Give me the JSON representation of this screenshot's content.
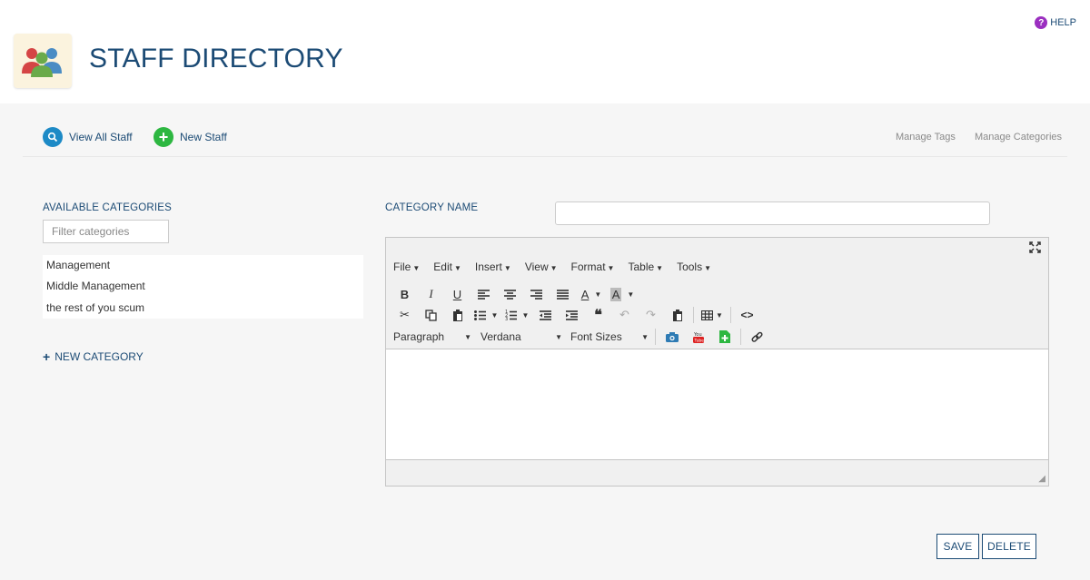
{
  "header": {
    "app_title": "STAFF DIRECTORY",
    "help_label": "HELP",
    "help_icon": "?"
  },
  "actions": {
    "view_all_label": "View All Staff",
    "new_staff_label": "New Staff",
    "manage_tags_label": "Manage Tags",
    "manage_categories_label": "Manage Categories"
  },
  "categories": {
    "heading": "AVAILABLE CATEGORIES",
    "filter_placeholder": "Filter categories",
    "items": [
      "Management",
      "Middle Management",
      "the rest of you scum"
    ],
    "new_category_label": "NEW CATEGORY"
  },
  "category_form": {
    "name_label": "CATEGORY NAME",
    "name_value": ""
  },
  "editor": {
    "menus": [
      "File",
      "Edit",
      "Insert",
      "View",
      "Format",
      "Table",
      "Tools"
    ],
    "block_format": "Paragraph",
    "font_family": "Verdana",
    "font_size": "Font Sizes"
  },
  "buttons": {
    "save_label": "SAVE",
    "delete_label": "DELETE"
  },
  "colors": {
    "brand": "#1c4b75",
    "view_icon": "#1d8ac6",
    "new_icon": "#2db741",
    "help_icon": "#9b2fc0"
  }
}
